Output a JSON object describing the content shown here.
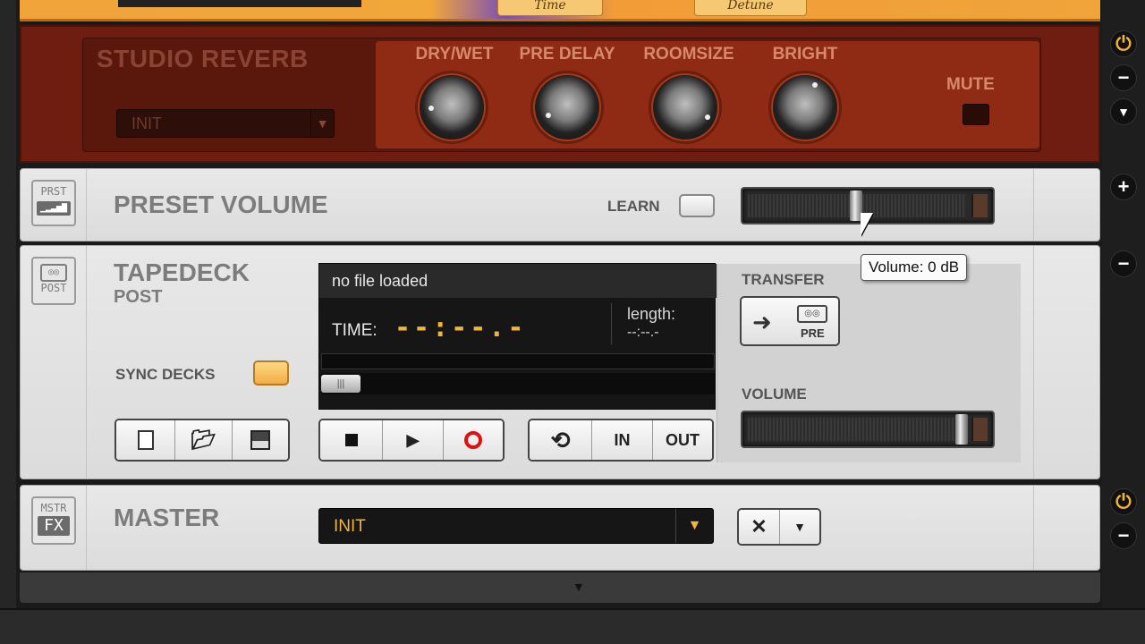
{
  "top_module": {
    "pill_left": "Time",
    "pill_right": "Detune"
  },
  "reverb": {
    "title": "STUDIO REVERB",
    "preset": "INIT",
    "knobs": [
      "DRY/WET",
      "PRE DELAY",
      "ROOMSIZE",
      "BRIGHT"
    ],
    "mute_label": "MUTE"
  },
  "preset_volume": {
    "badge_line1": "PRST",
    "title": "PRESET VOLUME",
    "learn_label": "LEARN",
    "tooltip": "Volume:  0 dB"
  },
  "tapedeck": {
    "badge_line2": "POST",
    "title": "TAPEDECK",
    "subtitle": "POST",
    "file_status": "no file loaded",
    "time_label": "TIME:",
    "time_value": "--:--.-",
    "length_label": "length:",
    "length_value": "--:--.-",
    "sync_label": "SYNC DECKS",
    "transfer_label": "TRANSFER",
    "transfer_target": "PRE",
    "volume_label": "VOLUME",
    "loop_in": "IN",
    "loop_out": "OUT"
  },
  "master": {
    "badge_line1": "MSTR",
    "badge_line2": "FX",
    "title": "MASTER",
    "preset": "INIT"
  },
  "colors": {
    "accent": "#f4b536",
    "reverb_red": "#8f2a14",
    "record_red": "#e01010"
  }
}
